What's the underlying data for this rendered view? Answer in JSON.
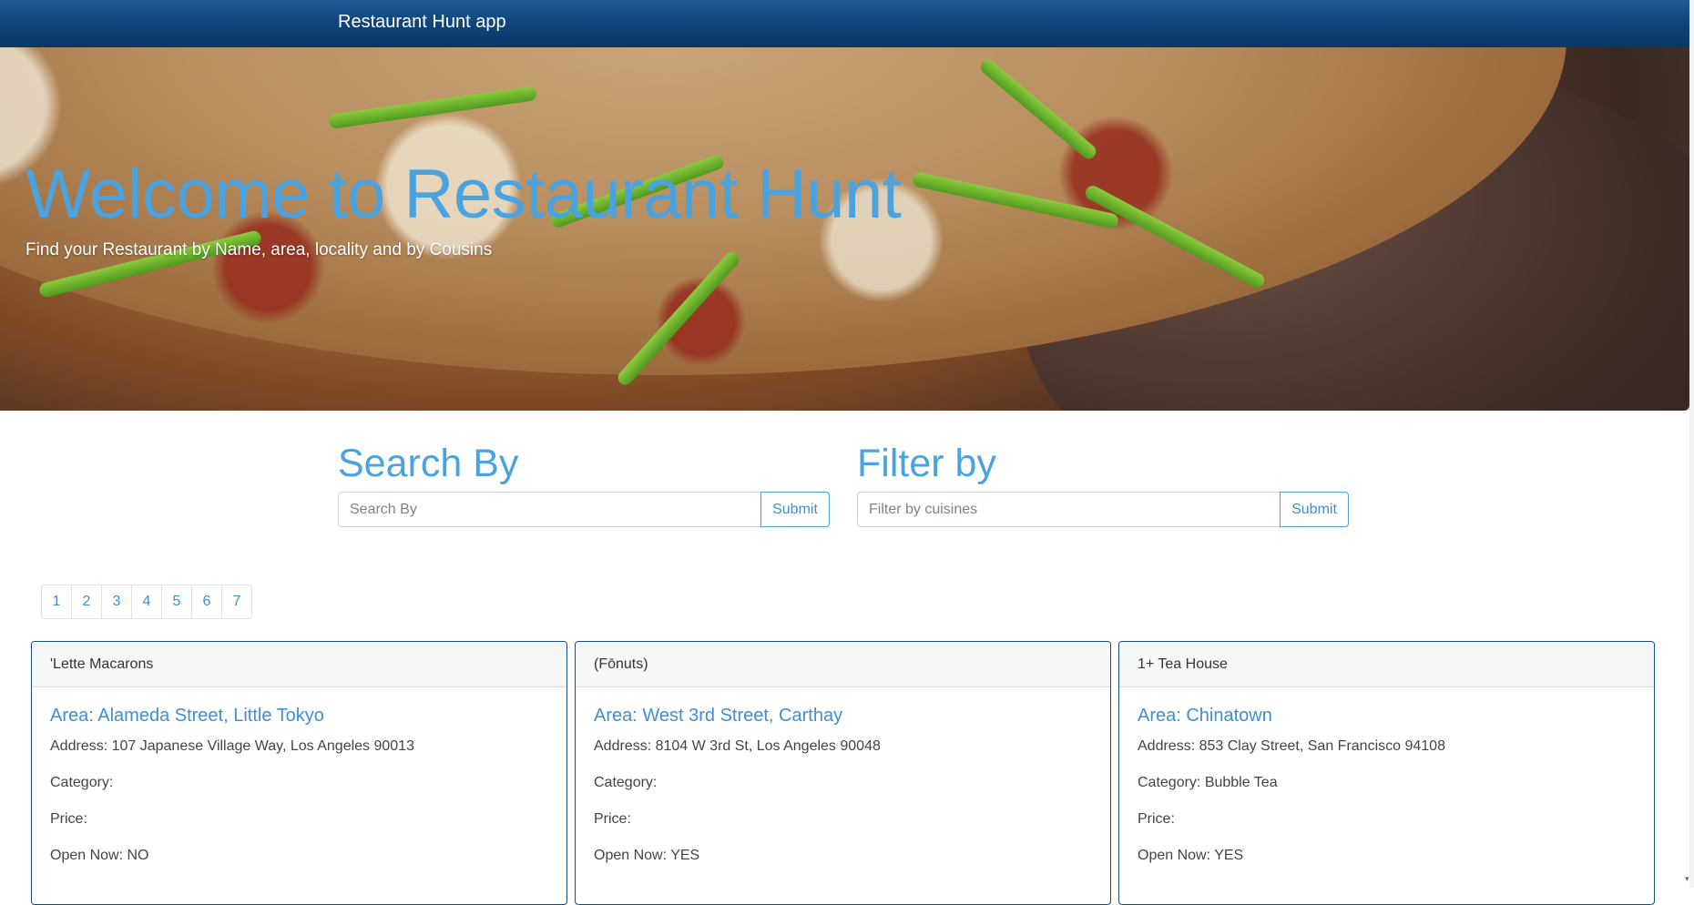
{
  "navbar": {
    "brand": "Restaurant Hunt app"
  },
  "hero": {
    "title": "Welcome to Restaurant Hunt",
    "subtitle": "Find your Restaurant by Name, area, locality and by Cousins"
  },
  "search": {
    "heading": "Search By",
    "placeholder": "Search By",
    "value": "",
    "submit_label": "Submit"
  },
  "filter": {
    "heading": "Filter by",
    "placeholder": "Filter by cuisines",
    "value": "",
    "submit_label": "Submit"
  },
  "pagination": [
    "1",
    "2",
    "3",
    "4",
    "5",
    "6",
    "7"
  ],
  "restaurants": [
    {
      "name": "'Lette Macarons",
      "area": "Area: Alameda Street, Little Tokyo",
      "address": "Address: 107 Japanese Village Way, Los Angeles 90013",
      "category": "Category:",
      "price": "Price:",
      "open_now": "Open Now: NO"
    },
    {
      "name": "(Fōnuts)",
      "area": "Area: West 3rd Street, Carthay",
      "address": "Address: 8104 W 3rd St, Los Angeles 90048",
      "category": "Category:",
      "price": "Price:",
      "open_now": "Open Now: YES"
    },
    {
      "name": "1+ Tea House",
      "area": "Area: Chinatown",
      "address": "Address: 853 Clay Street, San Francisco 94108",
      "category": "Category: Bubble Tea",
      "price": "Price:",
      "open_now": "Open Now: YES"
    }
  ],
  "colors": {
    "navbar": "#0f4278",
    "accent": "#4aa3df",
    "card_border": "#1b4c82"
  }
}
